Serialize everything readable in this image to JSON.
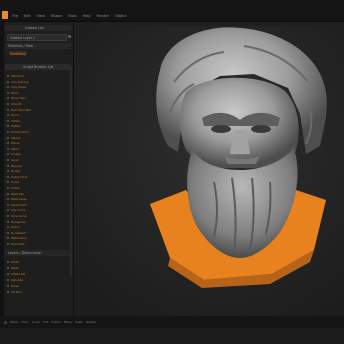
{
  "app": {
    "accent": "#f08a1f",
    "background": "#1b1b1b"
  },
  "menu": {
    "items": [
      "File",
      "Edit",
      "View",
      "Shape",
      "Tools",
      "Help",
      "Render",
      "Object"
    ]
  },
  "panel": {
    "header_label": "Subtool List",
    "search_value": "Subtool Layer 1",
    "section_label": "Materials / Rmtl",
    "tag_label": "Modelling",
    "group_label": "Sculpt Brushes List",
    "items": [
      "Standard",
      "Clay Buildup",
      "Clay Tubes",
      "Move",
      "Move Topo",
      "Smooth",
      "Dam Standard",
      "Pinch",
      "Inflate",
      "Flatten",
      "TrimDynamic",
      "hPolish",
      "Planar",
      "Slash",
      "Crease",
      "Layer",
      "Magnify",
      "Nudge",
      "Snake Hook",
      "Curve",
      "Chisel",
      "Mask Pen",
      "Mask Lasso",
      "Select Rect",
      "Clip Curve",
      "Slice Curve",
      "Transpose",
      "Gizmo",
      "DynaMesh",
      "ZRemesher",
      "Decimate"
    ],
    "lower_label": "Layers / Deformation",
    "lower_items": [
      "Polish",
      "Relax",
      "Inflate Bal",
      "Spherize",
      "Noise",
      "Surface"
    ]
  },
  "status": {
    "labels": [
      "Persp",
      "Floor",
      "Local",
      "XYZ",
      "Frame",
      "Move",
      "Scale",
      "Rotate"
    ]
  },
  "viewport": {
    "subject": "bust-sculpt",
    "base_color": "#f08a1f"
  }
}
